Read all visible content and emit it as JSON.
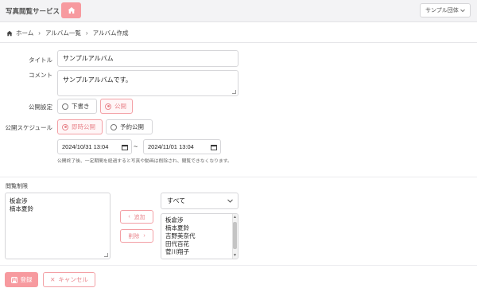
{
  "header": {
    "app_title": "写真閲覧サービス",
    "org_select": "サンプル団体"
  },
  "breadcrumb": {
    "items": [
      "ホーム",
      "アルバム一覧",
      "アルバム作成"
    ]
  },
  "form": {
    "title_label": "タイトル",
    "title_value": "サンプルアルバム",
    "comment_label": "コメント",
    "comment_value": "サンプルアルバムです。",
    "publish_setting_label": "公開設定",
    "publish_options": [
      "下書き",
      "公開"
    ],
    "publish_selected": "公開",
    "schedule_label": "公開スケジュール",
    "schedule_options": [
      "即時公開",
      "予約公開"
    ],
    "schedule_selected": "即時公開",
    "start_datetime": "2024/10/31 13:04",
    "end_datetime": "2024/11/01 13:04",
    "range_separator": "~",
    "schedule_note": "公開終了後、一定期間を経過すると写真や動画は削除され、閲覧できなくなります。"
  },
  "access": {
    "section_label": "閲覧制限",
    "allowed_users": [
      "板倉渉",
      "楠本夏鈴"
    ],
    "add_button": "追加",
    "remove_button": "削除",
    "filter_value": "すべて",
    "candidate_users": [
      "板倉渉",
      "楠本夏鈴",
      "吉野美奈代",
      "田代百花",
      "菅川翔子"
    ]
  },
  "actions": {
    "submit": "登録",
    "cancel": "キャンセル"
  },
  "colors": {
    "accent": "#f79a9f",
    "accent_text": "#e9868d"
  }
}
